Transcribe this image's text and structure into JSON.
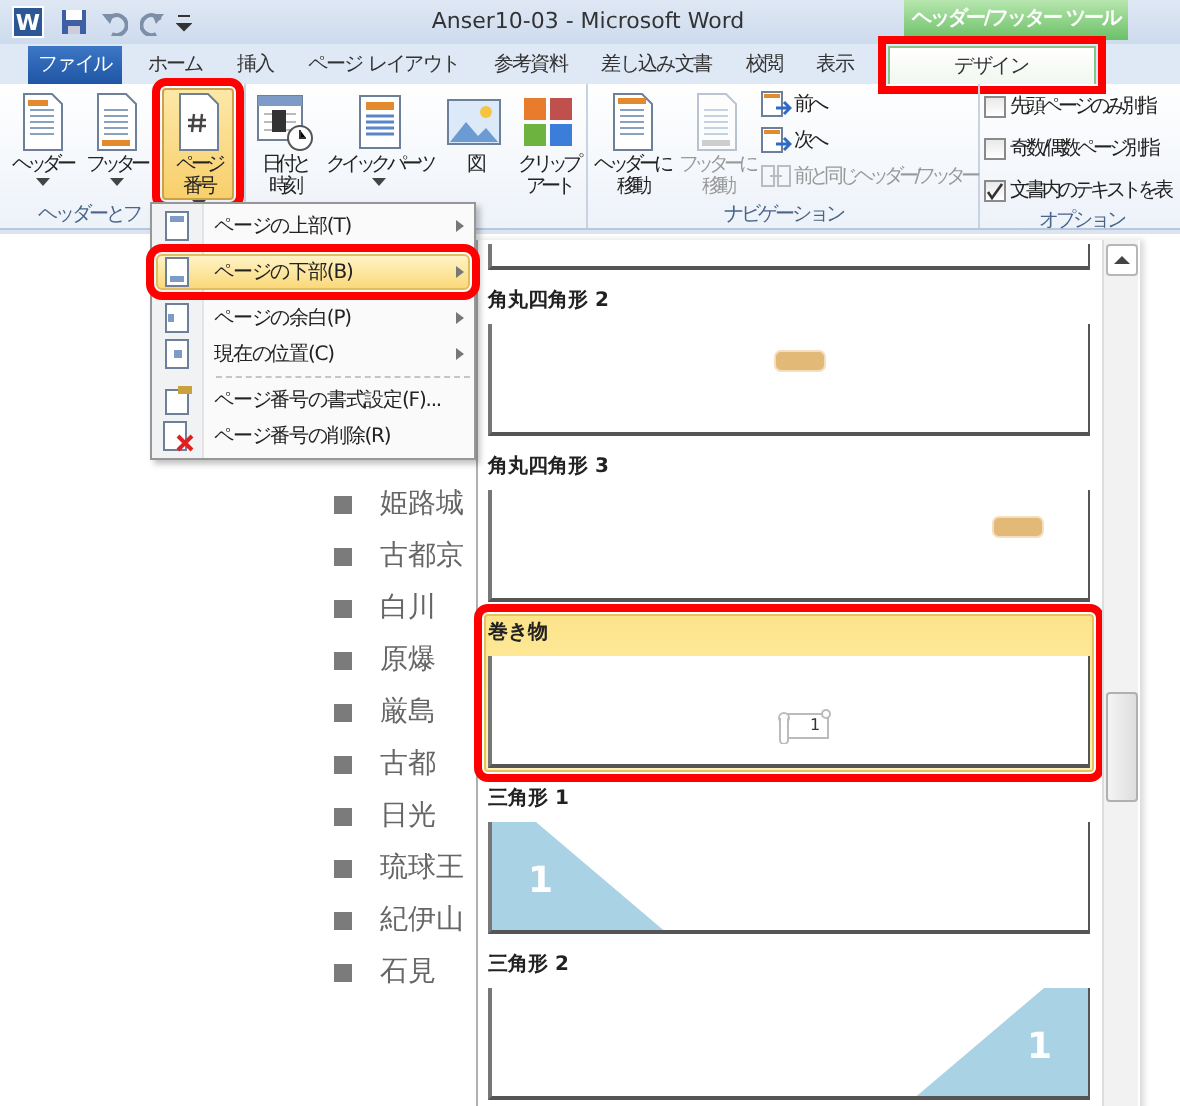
{
  "window": {
    "title": "Anser10-03 - Microsoft Word",
    "app_icon": "W"
  },
  "contextual_tab_group": "ヘッダー/フッター ツール",
  "tabs": [
    {
      "label": "ファイル",
      "kind": "file",
      "selected": false,
      "highlighted": false
    },
    {
      "label": "ホーム",
      "kind": "tab",
      "selected": false,
      "highlighted": false
    },
    {
      "label": "挿入",
      "kind": "tab",
      "selected": false,
      "highlighted": false
    },
    {
      "label": "ページ レイアウト",
      "kind": "tab",
      "selected": false,
      "highlighted": false
    },
    {
      "label": "参考資料",
      "kind": "tab",
      "selected": false,
      "highlighted": false
    },
    {
      "label": "差し込み文書",
      "kind": "tab",
      "selected": false,
      "highlighted": false
    },
    {
      "label": "校閲",
      "kind": "tab",
      "selected": false,
      "highlighted": false
    },
    {
      "label": "表示",
      "kind": "tab",
      "selected": false,
      "highlighted": false
    },
    {
      "label": "デザイン",
      "kind": "contextual",
      "selected": true,
      "highlighted": true
    }
  ],
  "ribbon": {
    "groups": [
      {
        "label": "ヘッダーとフ",
        "items": [
          {
            "kind": "large",
            "lines": [
              "ヘッダー"
            ],
            "dropdown": true,
            "pressed": false,
            "disabled": false,
            "highlighted": false
          },
          {
            "kind": "large",
            "lines": [
              "フッター"
            ],
            "dropdown": true,
            "pressed": false,
            "disabled": false,
            "highlighted": false
          },
          {
            "kind": "large",
            "lines": [
              "ページ",
              "番号"
            ],
            "dropdown": true,
            "pressed": true,
            "disabled": false,
            "highlighted": true
          }
        ]
      },
      {
        "items": [
          {
            "kind": "large",
            "lines": [
              "日付と",
              "時刻"
            ],
            "dropdown": false,
            "pressed": false,
            "disabled": false,
            "highlighted": false
          },
          {
            "kind": "large",
            "lines": [
              "クイック パーツ"
            ],
            "dropdown": true,
            "pressed": false,
            "disabled": false,
            "highlighted": false
          },
          {
            "kind": "large",
            "lines": [
              "図"
            ],
            "dropdown": false,
            "pressed": false,
            "disabled": false,
            "highlighted": false
          },
          {
            "kind": "large",
            "lines": [
              "クリップ",
              "アート"
            ],
            "dropdown": false,
            "pressed": false,
            "disabled": false,
            "highlighted": false
          }
        ]
      },
      {
        "label": "ナビゲーション",
        "items": [
          {
            "kind": "large",
            "lines": [
              "ヘッダーに",
              "移動"
            ],
            "dropdown": false,
            "pressed": false,
            "disabled": false,
            "highlighted": false
          },
          {
            "kind": "large",
            "lines": [
              "フッターに",
              "移動"
            ],
            "dropdown": false,
            "pressed": false,
            "disabled": true,
            "highlighted": false
          },
          {
            "kind": "small",
            "label": "前へ",
            "disabled": false
          },
          {
            "kind": "small",
            "label": "次へ",
            "disabled": false
          },
          {
            "kind": "small",
            "label": "前と同じヘッダー/フッター",
            "disabled": true
          }
        ]
      },
      {
        "label": "オプション",
        "items": [
          {
            "kind": "check",
            "label": "先頭ページのみ別指",
            "checked": false
          },
          {
            "kind": "check",
            "label": "奇数/偶数ページ別指",
            "checked": false
          },
          {
            "kind": "check",
            "label": "文書内のテキストを表",
            "checked": true
          }
        ]
      }
    ]
  },
  "document": {
    "bullets": [
      "姫路城",
      "古都京",
      "白川",
      "原爆",
      "厳島",
      "古都",
      "日光",
      "琉球王",
      "紀伊山",
      "石見"
    ]
  },
  "menu": [
    {
      "label": "ページの上部(T)",
      "submenu": true,
      "selected": false,
      "highlighted": false
    },
    {
      "label": "ページの下部(B)",
      "submenu": true,
      "selected": true,
      "highlighted": true
    },
    {
      "label": "ページの余白(P)",
      "submenu": true,
      "selected": false,
      "highlighted": false
    },
    {
      "label": "現在の位置(C)",
      "submenu": true,
      "selected": false,
      "highlighted": false
    },
    {
      "label": "ページ番号の書式設定(F)...",
      "submenu": false,
      "selected": false,
      "highlighted": false,
      "separator_before": true
    },
    {
      "label": "ページ番号の削除(R)",
      "submenu": false,
      "selected": false,
      "highlighted": false
    }
  ],
  "gallery": [
    {
      "kind": "partial",
      "selected": false,
      "highlighted": false
    },
    {
      "kind": "rounded-center",
      "label": "角丸四角形 2",
      "selected": false,
      "highlighted": false
    },
    {
      "kind": "rounded-right",
      "label": "角丸四角形 3",
      "selected": false,
      "highlighted": false
    },
    {
      "kind": "scroll",
      "label": "巻き物",
      "number": "1",
      "selected": true,
      "highlighted": true
    },
    {
      "kind": "triangle-left",
      "label": "三角形 1",
      "number": "1",
      "selected": false,
      "highlighted": false
    },
    {
      "kind": "triangle-right",
      "label": "三角形 2",
      "number": "1",
      "selected": false,
      "highlighted": false
    }
  ]
}
